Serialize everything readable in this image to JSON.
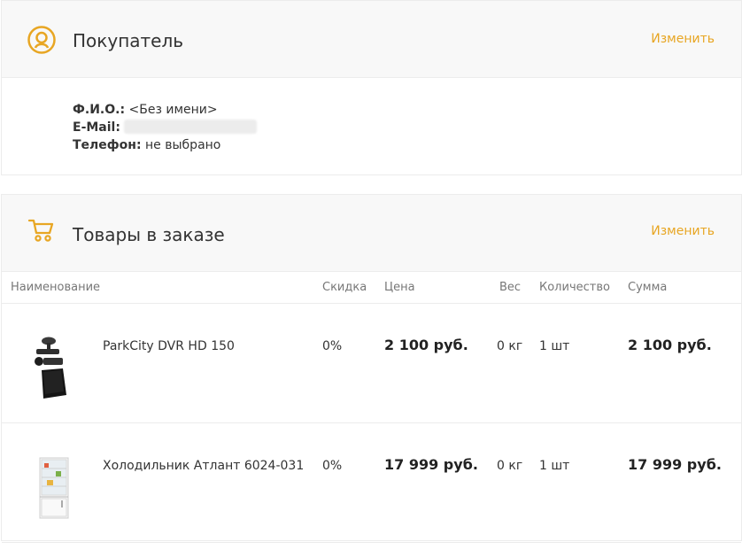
{
  "buyer": {
    "title": "Покупатель",
    "edit_label": "Изменить",
    "icon": "user-icon",
    "fio_label": "Ф.И.О.:",
    "fio_value": "<Без имени>",
    "email_label": "E-Mail:",
    "phone_label": "Телефон:",
    "phone_value": "не выбрано"
  },
  "order": {
    "title": "Товары в заказе",
    "edit_label": "Изменить",
    "icon": "cart-icon",
    "columns": {
      "name": "Наименование",
      "discount": "Скидка",
      "price": "Цена",
      "weight": "Вес",
      "quantity": "Количество",
      "sum": "Сумма"
    },
    "items": [
      {
        "name": "ParkCity DVR HD 150",
        "discount": "0%",
        "price": "2 100 руб.",
        "weight": "0 кг",
        "quantity": "1 шт",
        "sum": "2 100 руб.",
        "image": "dashcam-image"
      },
      {
        "name": "Холодильник Атлант 6024-031",
        "discount": "0%",
        "price": "17 999 руб.",
        "weight": "0 кг",
        "quantity": "1 шт",
        "sum": "17 999 руб.",
        "image": "fridge-image"
      }
    ]
  },
  "colors": {
    "accent": "#e8a623",
    "header_bg": "#f8f8f8",
    "border": "#ececec"
  }
}
